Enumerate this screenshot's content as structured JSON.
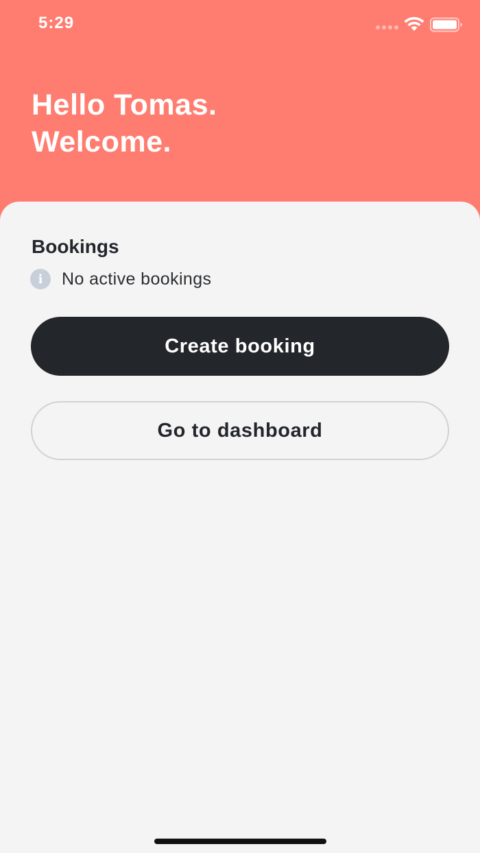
{
  "status_bar": {
    "time": "5:29",
    "wifi_icon": "wifi-icon",
    "battery_icon": "battery-icon"
  },
  "header": {
    "greeting_line1": "Hello Tomas.",
    "greeting_line2": "Welcome.",
    "background_color": "#ff7d70"
  },
  "bookings": {
    "title": "Bookings",
    "info_icon": "info-icon",
    "status_text": "No active bookings"
  },
  "actions": {
    "create_booking_label": "Create booking",
    "go_to_dashboard_label": "Go to dashboard"
  },
  "colors": {
    "accent": "#ff7d70",
    "primary_button": "#23262b",
    "sheet_background": "#f4f4f4"
  }
}
